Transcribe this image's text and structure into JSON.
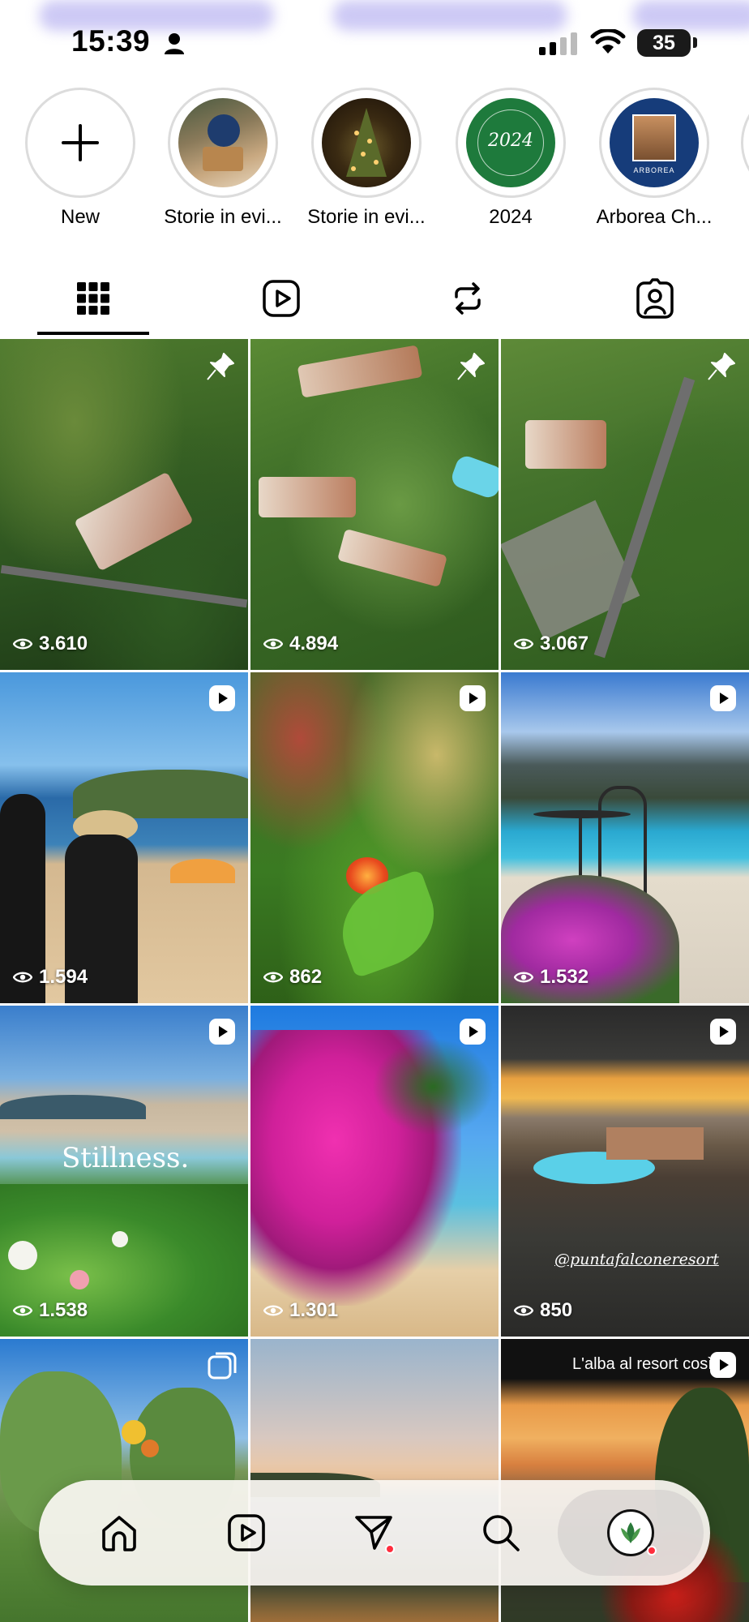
{
  "status_bar": {
    "time": "15:39",
    "battery": "35",
    "icons": [
      "person-icon",
      "signal-icon",
      "wifi-icon",
      "battery-icon"
    ]
  },
  "highlights": [
    {
      "label": "New",
      "icon": "plus-icon"
    },
    {
      "label": "Storie in evi..."
    },
    {
      "label": "Storie in evi..."
    },
    {
      "label": "2024",
      "cover_text": "2024"
    },
    {
      "label": "Arborea Ch...",
      "cover_text": "ARBOREA"
    }
  ],
  "tabs": [
    {
      "name": "posts",
      "icon": "grid-icon",
      "active": true
    },
    {
      "name": "reels",
      "icon": "reels-icon"
    },
    {
      "name": "reposts",
      "icon": "repost-icon"
    },
    {
      "name": "tagged",
      "icon": "tagged-icon"
    }
  ],
  "posts": [
    {
      "views": "3.610",
      "badge": "pin-icon"
    },
    {
      "views": "4.894",
      "badge": "pin-icon"
    },
    {
      "views": "3.067",
      "badge": "pin-icon"
    },
    {
      "views": "1.594",
      "badge": "reel-icon"
    },
    {
      "views": "862",
      "badge": "reel-icon"
    },
    {
      "views": "1.532",
      "badge": "reel-icon"
    },
    {
      "views": "1.538",
      "badge": "reel-icon",
      "overlay": "Stillness."
    },
    {
      "views": "1.301",
      "badge": "reel-icon"
    },
    {
      "views": "850",
      "badge": "reel-icon",
      "overlay": "@puntafalconeresort"
    },
    {
      "views": "",
      "badge": "carousel-icon"
    },
    {
      "views": "",
      "badge": ""
    },
    {
      "views": "",
      "badge": "reel-icon",
      "overlay": "L'alba al resort così"
    }
  ],
  "bottom_nav": [
    {
      "name": "home",
      "icon": "home-icon"
    },
    {
      "name": "reels",
      "icon": "reels-icon"
    },
    {
      "name": "messages",
      "icon": "send-icon",
      "notification": true
    },
    {
      "name": "search",
      "icon": "search-icon"
    },
    {
      "name": "profile",
      "icon": "profile-avatar",
      "active": true,
      "notification": true
    }
  ],
  "colors": {
    "accent": "#ff2d3d",
    "text": "#000000",
    "ring": "#dcdcdc"
  }
}
